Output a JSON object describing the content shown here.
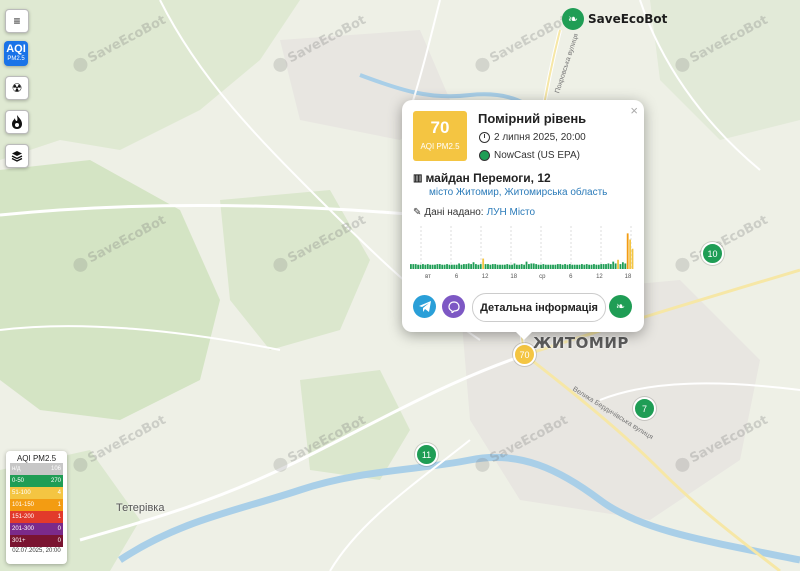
{
  "logo": {
    "text": "SaveEcoBot"
  },
  "watermark": "SaveEcoBot",
  "controls": {
    "aqi_button": {
      "title": "AQI",
      "sub": "PM2.5"
    }
  },
  "map_labels": {
    "city": "ЖИТОМИР",
    "town": "Тетерівка",
    "street1": "Покровська вулиця",
    "street2": "Велика Бердичівська вулиця"
  },
  "markers": [
    {
      "value": "10",
      "color": "green"
    },
    {
      "value": "70",
      "color": "yellow"
    },
    {
      "value": "7",
      "color": "green"
    },
    {
      "value": "11",
      "color": "green"
    }
  ],
  "popup": {
    "close": "×",
    "aqi_value": "70",
    "aqi_label": "AQI PM2.5",
    "level": "Помірний рівень",
    "datetime": "2 липня 2025, 20:00",
    "method": "NowCast (US EPA)",
    "address": "майдан Перемоги, 12",
    "city": "місто Житомир, Житомирська область",
    "provider_label": "Дані надано:",
    "provider": "ЛУН Місто",
    "detail_button": "Детальна інформація"
  },
  "chart_data": {
    "type": "bar",
    "x_tick_labels": [
      "вт",
      "6",
      "12",
      "18",
      "ср",
      "6",
      "12",
      "18"
    ],
    "values": [
      8,
      8,
      8,
      7,
      7,
      8,
      7,
      8,
      7,
      7,
      7,
      8,
      8,
      7,
      7,
      8,
      7,
      7,
      7,
      7,
      9,
      7,
      8,
      8,
      9,
      8,
      11,
      8,
      7,
      8,
      17,
      8,
      8,
      7,
      8,
      8,
      7,
      7,
      7,
      7,
      8,
      7,
      7,
      9,
      7,
      7,
      8,
      7,
      12,
      8,
      9,
      9,
      8,
      7,
      7,
      8,
      7,
      7,
      7,
      7,
      7,
      8,
      8,
      7,
      8,
      7,
      8,
      7,
      7,
      7,
      7,
      8,
      7,
      8,
      7,
      7,
      8,
      7,
      7,
      8,
      8,
      8,
      9,
      8,
      12,
      9,
      15,
      8,
      11,
      9,
      58,
      48,
      33
    ],
    "colors": {
      "good": "#1f9d55",
      "moderate": "#f4c542",
      "sensitive": "#f39c12"
    },
    "ylim": [
      0,
      70
    ]
  },
  "legend": {
    "title": "AQI PM2.5",
    "rows": [
      {
        "range": "н/д",
        "count": "106",
        "color": "#c7c7c7"
      },
      {
        "range": "0-50",
        "count": "270",
        "color": "#1f9d55"
      },
      {
        "range": "51-100",
        "count": "4",
        "color": "#f4c542"
      },
      {
        "range": "101-150",
        "count": "1",
        "color": "#f39c12"
      },
      {
        "range": "151-200",
        "count": "1",
        "color": "#e23a2b"
      },
      {
        "range": "201-300",
        "count": "0",
        "color": "#7b2a8a"
      },
      {
        "range": "301+",
        "count": "0",
        "color": "#7a1431"
      }
    ],
    "date": "02.07.2025, 20:00"
  }
}
